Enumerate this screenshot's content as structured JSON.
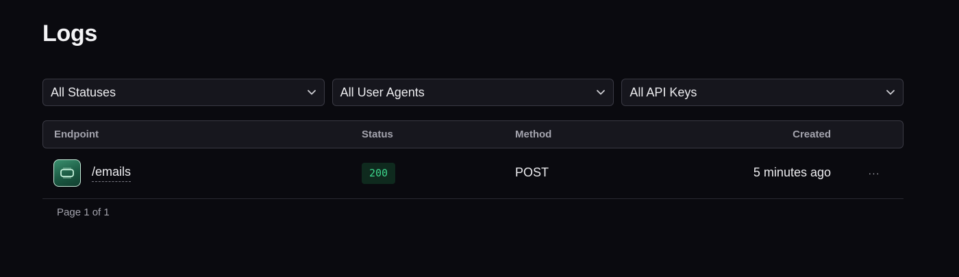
{
  "page": {
    "title": "Logs"
  },
  "filters": {
    "status": "All Statuses",
    "user_agent": "All User Agents",
    "api_key": "All API Keys"
  },
  "table": {
    "columns": {
      "endpoint": "Endpoint",
      "status": "Status",
      "method": "Method",
      "created": "Created"
    },
    "rows": [
      {
        "endpoint": "/emails",
        "status": "200",
        "method": "POST",
        "created": "5 minutes ago",
        "icon": "email-endpoint-icon",
        "more": "···"
      }
    ]
  },
  "pagination": {
    "label": "Page 1 of 1"
  },
  "colors": {
    "background": "#0a0a0f",
    "success": "#3dd68c",
    "success_bg": "#0f2a1e",
    "border": "#3a3a44"
  }
}
